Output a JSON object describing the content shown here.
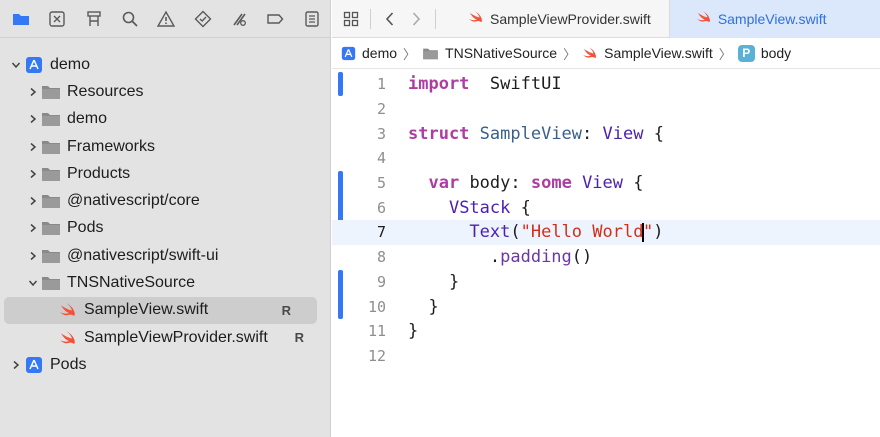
{
  "colors": {
    "accent": "#3478f6",
    "folder": "#7a7a7a",
    "swift": "#f05138",
    "keyword": "#ad3da4",
    "string": "#d12f1b"
  },
  "navigator": {
    "toolbar_icons": [
      "folder-icon",
      "source-control-icon",
      "hierarchy-icon",
      "search-icon",
      "warning-icon",
      "test-icon",
      "debug-icon",
      "breakpoint-icon",
      "report-icon"
    ],
    "tree": [
      {
        "label": "demo",
        "icon": "project-icon",
        "expanded": true,
        "level": 0
      },
      {
        "label": "Resources",
        "icon": "folder-icon",
        "expanded": false,
        "level": 1
      },
      {
        "label": "demo",
        "icon": "folder-icon",
        "expanded": false,
        "level": 1
      },
      {
        "label": "Frameworks",
        "icon": "folder-icon",
        "expanded": false,
        "level": 1
      },
      {
        "label": "Products",
        "icon": "folder-icon",
        "expanded": false,
        "level": 1
      },
      {
        "label": "@nativescript/core",
        "icon": "folder-icon",
        "expanded": false,
        "level": 1
      },
      {
        "label": "Pods",
        "icon": "folder-icon",
        "expanded": false,
        "level": 1
      },
      {
        "label": "@nativescript/swift-ui",
        "icon": "folder-icon",
        "expanded": false,
        "level": 1
      },
      {
        "label": "TNSNativeSource",
        "icon": "folder-icon",
        "expanded": true,
        "level": 1
      },
      {
        "label": "SampleView.swift",
        "icon": "swift-file-icon",
        "badge": "R",
        "selected": true,
        "level": 2
      },
      {
        "label": "SampleViewProvider.swift",
        "icon": "swift-file-icon",
        "badge": "R",
        "level": 2
      },
      {
        "label": "Pods",
        "icon": "project-icon",
        "expanded": false,
        "level": 0
      }
    ]
  },
  "editor": {
    "tabs": [
      {
        "label": "SampleViewProvider.swift",
        "active": false
      },
      {
        "label": "SampleView.swift",
        "active": true
      }
    ],
    "jumpbar": {
      "project": "demo",
      "folder": "TNSNativeSource",
      "file": "SampleView.swift",
      "symbol_badge": "P",
      "symbol": "body"
    },
    "current_line": 7,
    "lines": [
      {
        "n": "1",
        "tokens": [
          [
            "kw",
            "import"
          ],
          [
            "",
            "  "
          ],
          [
            "",
            "SwiftUI"
          ]
        ]
      },
      {
        "n": "2",
        "tokens": []
      },
      {
        "n": "3",
        "tokens": [
          [
            "kw",
            "struct"
          ],
          [
            "",
            " "
          ],
          [
            "ty",
            "SampleView"
          ],
          [
            "",
            ": "
          ],
          [
            "tyb",
            "View"
          ],
          [
            "",
            " {"
          ]
        ]
      },
      {
        "n": "4",
        "tokens": []
      },
      {
        "n": "5",
        "tokens": [
          [
            "",
            "  "
          ],
          [
            "kw",
            "var"
          ],
          [
            "",
            " body: "
          ],
          [
            "kw",
            "some"
          ],
          [
            "",
            " "
          ],
          [
            "tyb",
            "View"
          ],
          [
            "",
            " {"
          ]
        ]
      },
      {
        "n": "6",
        "tokens": [
          [
            "",
            "    "
          ],
          [
            "tyb",
            "VStack"
          ],
          [
            "",
            " {"
          ]
        ]
      },
      {
        "n": "7",
        "tokens": [
          [
            "",
            "      "
          ],
          [
            "tyb",
            "Text"
          ],
          [
            "",
            "("
          ],
          [
            "str",
            "\"Hello World"
          ],
          [
            "caret",
            ""
          ],
          [
            "str",
            "\""
          ],
          [
            "",
            ")"
          ]
        ]
      },
      {
        "n": "8",
        "tokens": [
          [
            "",
            "        ."
          ],
          [
            "fn",
            "padding"
          ],
          [
            "",
            "()"
          ]
        ]
      },
      {
        "n": "9",
        "tokens": [
          [
            "",
            "    }"
          ]
        ]
      },
      {
        "n": "10",
        "tokens": [
          [
            "",
            "  }"
          ]
        ]
      },
      {
        "n": "11",
        "tokens": [
          [
            "",
            "}"
          ]
        ]
      },
      {
        "n": "12",
        "tokens": []
      }
    ]
  }
}
